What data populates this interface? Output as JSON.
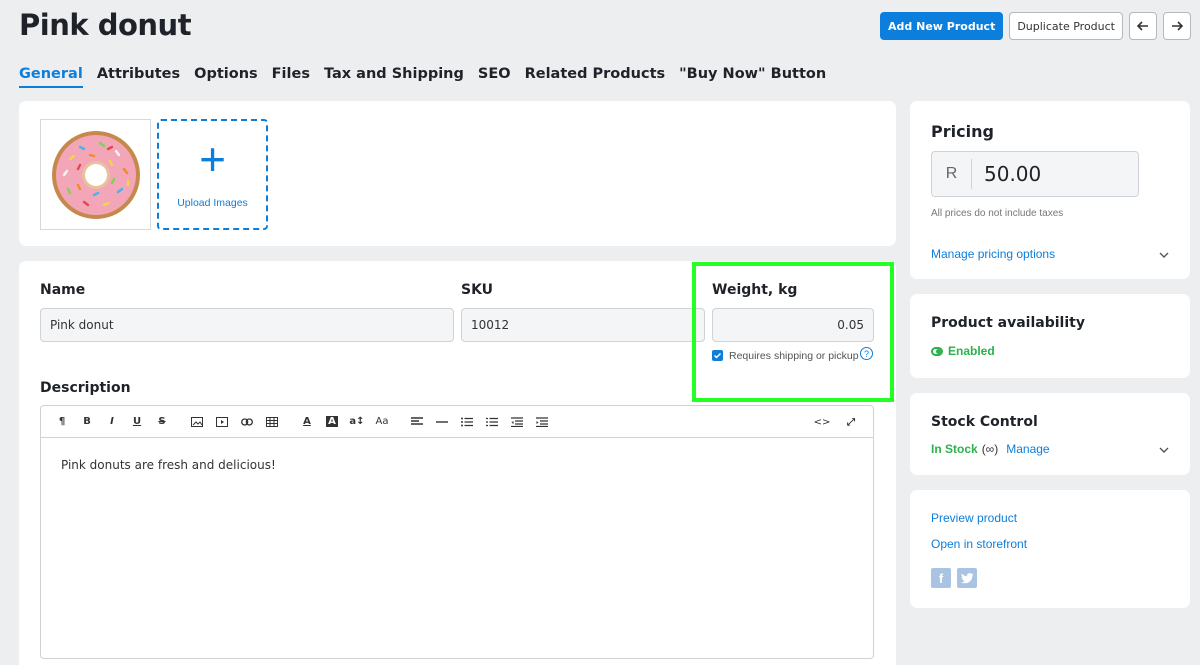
{
  "page": {
    "title": "Pink donut"
  },
  "top_actions": {
    "add_new_label": "Add New Product",
    "duplicate_label": "Duplicate Product",
    "prev_icon": "arrow-left-icon",
    "next_icon": "arrow-right-icon"
  },
  "tabs": [
    {
      "label": "General",
      "active": true
    },
    {
      "label": "Attributes"
    },
    {
      "label": "Options"
    },
    {
      "label": "Files"
    },
    {
      "label": "Tax and Shipping"
    },
    {
      "label": "SEO"
    },
    {
      "label": "Related Products"
    },
    {
      "label": "\"Buy Now\" Button"
    }
  ],
  "images": {
    "upload_label": "Upload Images",
    "plus_glyph": "+"
  },
  "details": {
    "name_label": "Name",
    "name_value": "Pink donut",
    "sku_label": "SKU",
    "sku_value": "10012",
    "weight_label": "Weight, kg",
    "weight_value": "0.05",
    "requires_shipping_label": "Requires shipping or pickup",
    "requires_shipping_checked": true,
    "help_glyph": "?",
    "description_label": "Description",
    "description_text": "Pink donuts are fresh and delicious!"
  },
  "editor_toolbar": {
    "paragraph": "¶",
    "bold": "B",
    "italic": "I",
    "underline": "U",
    "strike": "S",
    "font_color": "A",
    "bg_color": "A",
    "font_size": "a↕",
    "font_family": "Aa",
    "code": "<>",
    "fullscreen": "⤢"
  },
  "pricing": {
    "title": "Pricing",
    "currency": "R",
    "price": "50.00",
    "note": "All prices do not include taxes",
    "manage_label": "Manage pricing options"
  },
  "availability": {
    "title": "Product availability",
    "status": "Enabled",
    "status_color": "#2bb24c"
  },
  "stock": {
    "title": "Stock Control",
    "status": "In Stock",
    "infinity": "(∞)",
    "manage_label": "Manage"
  },
  "links": {
    "preview_label": "Preview product",
    "storefront_label": "Open in storefront",
    "facebook_glyph": "f",
    "twitter_glyph": "t"
  },
  "colors": {
    "accent": "#0c7edb",
    "highlight": "#24ff24",
    "success": "#2bb24c"
  }
}
